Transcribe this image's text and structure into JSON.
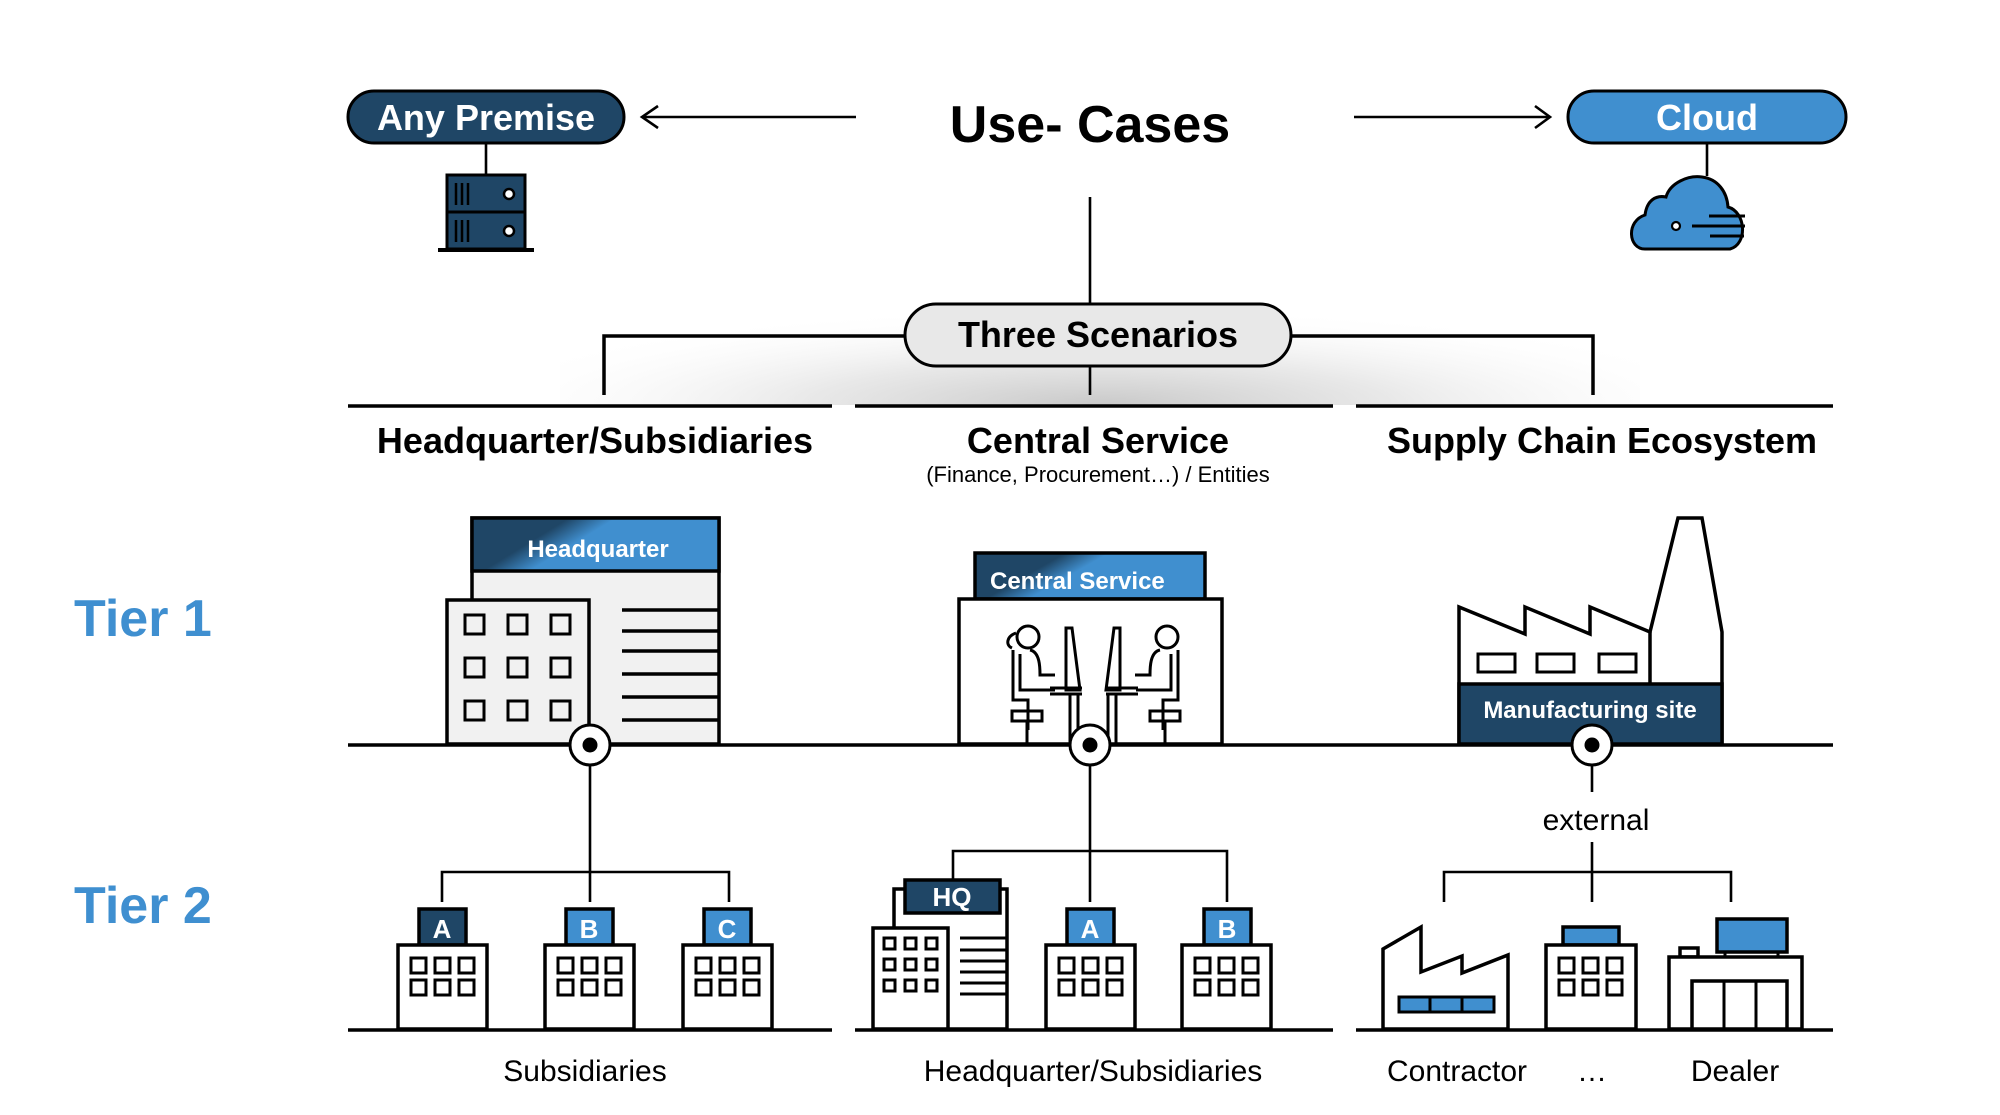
{
  "title": "Use- Cases",
  "deployment": {
    "left": {
      "label": "Any Premise",
      "icon": "server-icon"
    },
    "right": {
      "label": "Cloud",
      "icon": "cloud-icon"
    }
  },
  "hub": {
    "label": "Three Scenarios"
  },
  "tiers": [
    {
      "label": "Tier 1"
    },
    {
      "label": "Tier 2"
    }
  ],
  "scenarios": [
    {
      "heading": "Headquarter/Subsidiaries",
      "subheading": "",
      "tier1": {
        "label": "Headquarter",
        "icon": "office-building-icon"
      },
      "tier2": {
        "children": [
          {
            "badge": "A",
            "icon": "building-icon"
          },
          {
            "badge": "B",
            "icon": "building-icon"
          },
          {
            "badge": "C",
            "icon": "building-icon"
          }
        ],
        "caption": "Subsidiaries"
      }
    },
    {
      "heading": "Central Service",
      "subheading": "(Finance, Procurement…) / Entities",
      "tier1": {
        "label": "Central Service",
        "icon": "office-workers-icon"
      },
      "tier2": {
        "children": [
          {
            "badge": "HQ",
            "icon": "office-building-icon"
          },
          {
            "badge": "A",
            "icon": "building-icon"
          },
          {
            "badge": "B",
            "icon": "building-icon"
          }
        ],
        "caption": "Headquarter/Subsidiaries"
      }
    },
    {
      "heading": "Supply Chain Ecosystem",
      "subheading": "",
      "tier1": {
        "label": "Manufacturing site",
        "icon": "factory-icon"
      },
      "connector_label": "external",
      "tier2": {
        "children": [
          {
            "caption": "Contractor",
            "icon": "factory-icon"
          },
          {
            "caption": "…",
            "icon": "building-icon"
          },
          {
            "caption": "Dealer",
            "icon": "shop-icon"
          }
        ]
      }
    }
  ],
  "colors": {
    "dark_blue": "#1f4666",
    "light_blue": "#408fcf",
    "tier_label": "#3f8fd0",
    "pill_grey": "#e8e8e8",
    "building_grey": "#f1f1f1"
  }
}
